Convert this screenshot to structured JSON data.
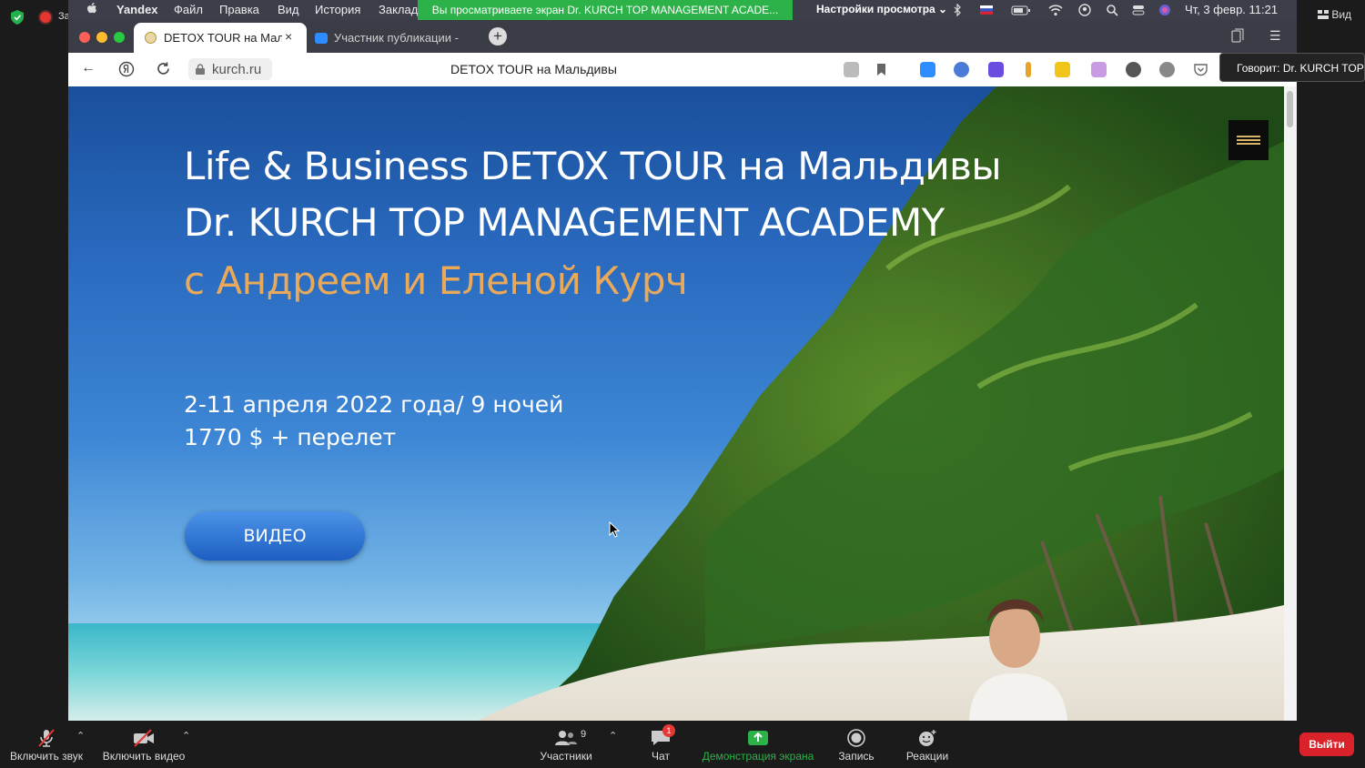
{
  "zoom": {
    "recording_label": "Запись",
    "view_label": "Вид",
    "speaking_label": "Говорит: Dr. KURCH TOP",
    "share_banner": "Вы просматриваете экран Dr. KURCH TOP MANAGEMENT ACADE...",
    "view_settings_label": "Настройки просмотра",
    "bottom": {
      "mute_label": "Включить звук",
      "video_label": "Включить видео",
      "participants_label": "Участники",
      "participants_count": "9",
      "chat_label": "Чат",
      "chat_badge": "1",
      "share_label": "Демонстрация экрана",
      "record_label": "Запись",
      "reactions_label": "Реакции",
      "leave_label": "Выйти"
    },
    "colors": {
      "share_green": "#2db24a",
      "leave_red": "#d9222a"
    }
  },
  "macos": {
    "menu": [
      "Yandex",
      "Файл",
      "Правка",
      "Вид",
      "История",
      "Заклад"
    ],
    "clock": "Чт, 3 февр.  11:21"
  },
  "browser": {
    "tabs": [
      {
        "title": "DETOX TOUR на Мальдивы",
        "close": "×"
      },
      {
        "title": "Участник публикации - Zoom"
      }
    ],
    "new_tab": "+",
    "url": "kurch.ru",
    "page_title": "DETOX TOUR на Мальдивы"
  },
  "page": {
    "headline_1": "Life & Business DETOX TOUR на Мальдивы",
    "headline_2": "Dr. KURCH TOP MANAGEMENT ACADEMY",
    "headline_3": "с Андреем и Еленой Курч",
    "dates": "2-11 апреля 2022 года/ 9 ночей",
    "price": "1770 $ + перелет",
    "video_button": "ВИДЕО",
    "accent_color": "#e8a95a"
  }
}
